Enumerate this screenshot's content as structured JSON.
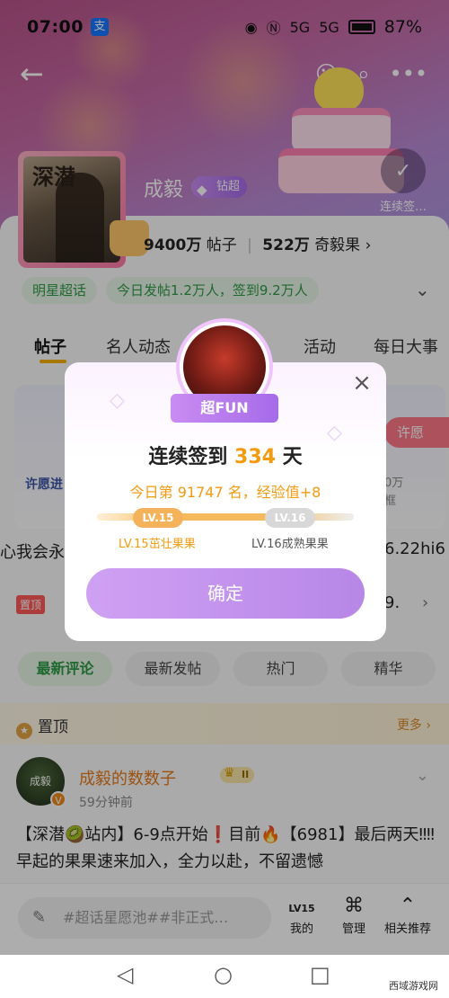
{
  "status_bar": {
    "time": "07:00",
    "alipay": "支",
    "signal1": "5G",
    "signal2": "5G",
    "battery": "87%"
  },
  "header": {
    "sign_in_label": "连续签…"
  },
  "profile": {
    "name": "成毅",
    "badge": "钻超",
    "posts_count": "9400万",
    "posts_label": "帖子",
    "fans_count": "522万",
    "fans_label": "奇毅果",
    "avatar_text": "深潜",
    "tags": [
      "明星超话",
      "今日发帖1.2万人，签到9.2万人"
    ]
  },
  "tabs": [
    "帖子",
    "名人动态",
    "活动",
    "每日大事"
  ],
  "wish": {
    "left_text": "许愿进",
    "button": "许愿",
    "right_text_1": "0万",
    "right_text_2": "框"
  },
  "feed_line": {
    "left": "心我会永",
    "right": "6.22hi6"
  },
  "pin_row": {
    "tag": "置顶",
    "right": "9."
  },
  "filters": [
    "最新评论",
    "最新发帖",
    "热门",
    "精华"
  ],
  "pinned": {
    "title": "置顶",
    "more": "更多"
  },
  "post": {
    "avatar_text": "成毅",
    "name": "成毅的数数子",
    "level": "II",
    "time": "59分钟前",
    "body": "【深潜🥝站内】6-9点开始❗目前🔥【6981】最后两天‼‼早起的果果速来加入，全力以赴，不留遗憾"
  },
  "bottom_bar": {
    "compose_placeholder": "#超话星愿池##非正式…",
    "mine": "我的",
    "mine_badge": "LV15",
    "manage": "管理",
    "related": "相关推荐"
  },
  "modal": {
    "ribbon": "超FUN",
    "title_prefix": "连续签到",
    "days": "334",
    "title_suffix": "天",
    "subtitle": "今日第 91747 名，经验值+8",
    "current_level": "LV.15",
    "next_level": "LV.16",
    "current_name": "LV.15茁壮果果",
    "next_name": "LV.16成熟果果",
    "progress": 0.65,
    "confirm": "确定"
  },
  "watermark": "西域游戏网",
  "colors": {
    "accent": "#f29b0f",
    "purple": "#b787e7",
    "green": "#2e9a46"
  }
}
